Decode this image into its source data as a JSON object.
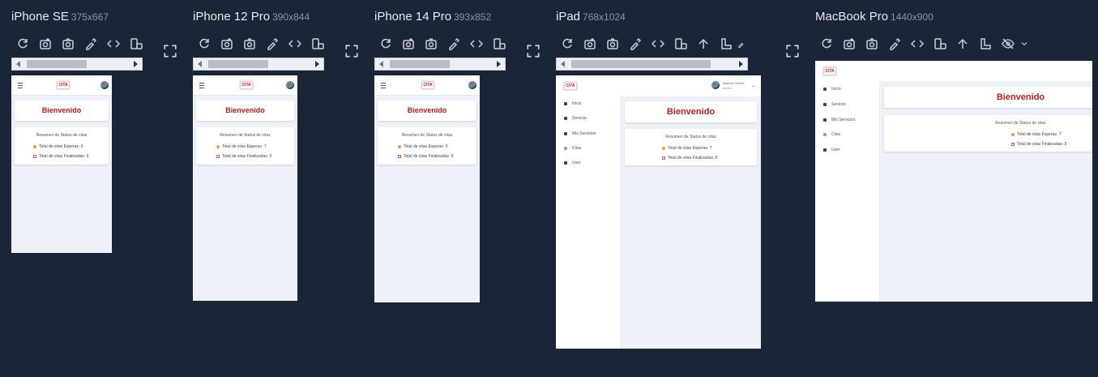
{
  "devices": [
    {
      "name": "iPhone SE",
      "res": "375x667"
    },
    {
      "name": "iPhone 12 Pro",
      "res": "390x844"
    },
    {
      "name": "iPhone 14 Pro",
      "res": "393x852"
    },
    {
      "name": "iPad",
      "res": "768x1024"
    },
    {
      "name": "MacBook Pro",
      "res": "1440x900"
    }
  ],
  "app": {
    "logo": "CITA",
    "welcome": "Bienvenido",
    "resumen_mobile": "Resumen de Status de citas",
    "resumen": "Resumen de Status de citas",
    "stat_pending_mobile": "Total de citas Esperas: 0",
    "stat_done_mobile": "Total de citas Finalizadas: 9",
    "stat_pending": "Total de citas Esperas: 7",
    "stat_done": "Total de citas Finalizadas: 5",
    "menu": [
      "Inicio",
      "Servicio",
      "Mis Servicios",
      "Citas",
      "User"
    ],
    "user_name": "Maximo Nuñez",
    "user_role": "admin"
  },
  "colors": {
    "accent": "#c21b1b",
    "background": "#1b2538",
    "pending": "#e6a23c"
  },
  "icons": {
    "tools": [
      "reload-icon",
      "screenshot-device-icon",
      "camera-icon",
      "eyedropper-icon",
      "code-icon",
      "rotate-icon",
      "arrow-up-icon",
      "ruler-icon",
      "eye-off-icon"
    ]
  }
}
